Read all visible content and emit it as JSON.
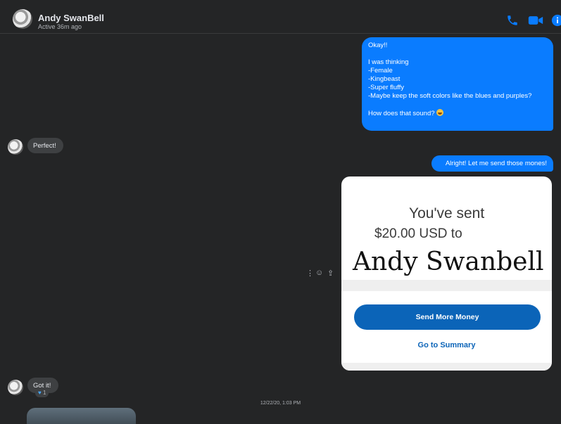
{
  "header": {
    "name": "Andy SwanBell",
    "status": "Active 36m ago",
    "icons": [
      "phone-icon",
      "video-icon",
      "info-icon"
    ],
    "accent": "#0a7cff"
  },
  "messages": {
    "outgoing_1": {
      "lines": [
        "Okay!!",
        "",
        "I was thinking",
        "-Female",
        "-Kingbeast",
        "-Super fluffy",
        "-Maybe keep the soft colors like the blues and purples?",
        ""
      ],
      "last_line": "How does that sound?"
    },
    "incoming_1": "Perfect!",
    "outgoing_2": "Alright! Let me send those mones!",
    "incoming_2": "Got it!",
    "reaction_count": "1"
  },
  "payment_card": {
    "sent_text": "You've sent",
    "amount_text": "$20.00 USD to",
    "recipient": "Andy Swanbell",
    "send_more_label": "Send More Money",
    "summary_label": "Go to Summary",
    "button_color": "#0b64b8"
  },
  "timestamp": "12/22/20, 1:03 PM"
}
